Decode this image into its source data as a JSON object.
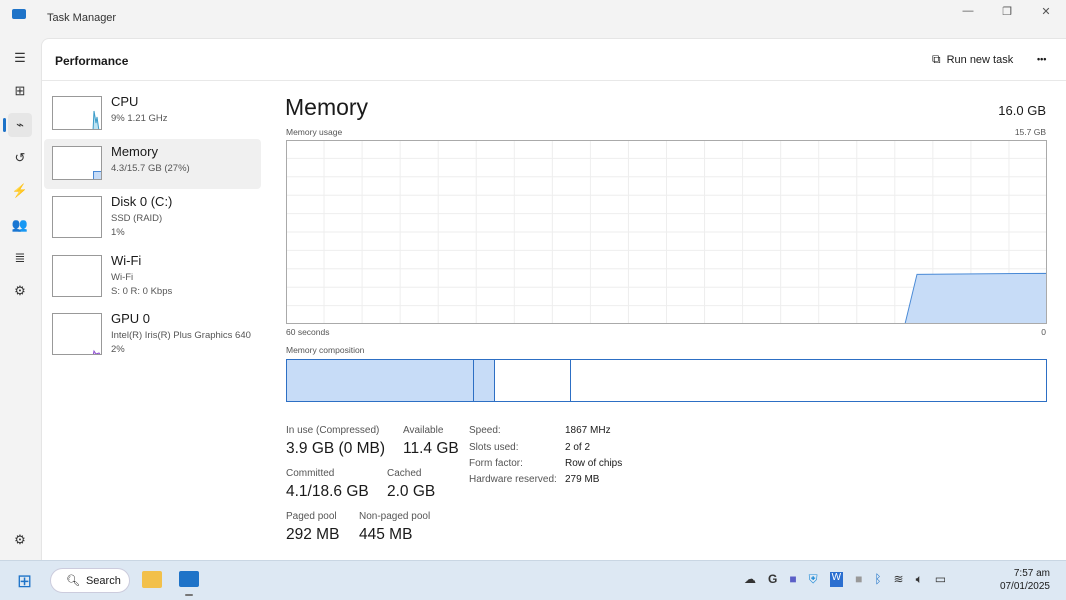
{
  "app": {
    "title": "Task Manager"
  },
  "header": {
    "title": "Performance",
    "run_new_task": "Run new task",
    "more": "•••"
  },
  "sidebar": {
    "items": [
      {
        "name": "CPU",
        "line1": "9%  1.21 GHz",
        "line2": ""
      },
      {
        "name": "Memory",
        "line1": "4.3/15.7 GB (27%)",
        "line2": ""
      },
      {
        "name": "Disk 0 (C:)",
        "line1": "SSD (RAID)",
        "line2": "1%"
      },
      {
        "name": "Wi-Fi",
        "line1": "Wi-Fi",
        "line2": "S: 0  R: 0 Kbps"
      },
      {
        "name": "GPU 0",
        "line1": "Intel(R) Iris(R) Plus Graphics 640",
        "line2": "2%"
      }
    ]
  },
  "main": {
    "title": "Memory",
    "total": "16.0 GB",
    "usage_label": "Memory usage",
    "usage_max": "15.7 GB",
    "axis_left": "60 seconds",
    "axis_right": "0",
    "usage_fraction": 0.27,
    "composition_label": "Memory composition",
    "stats": {
      "in_use_label": "In use (Compressed)",
      "in_use": "3.9 GB (0 MB)",
      "available_label": "Available",
      "available": "11.4 GB",
      "committed_label": "Committed",
      "committed": "4.1/18.6 GB",
      "cached_label": "Cached",
      "cached": "2.0 GB",
      "paged_label": "Paged pool",
      "paged": "292 MB",
      "nonpaged_label": "Non-paged pool",
      "nonpaged": "445 MB"
    },
    "details": [
      {
        "label": "Speed:",
        "value": "1867 MHz"
      },
      {
        "label": "Slots used:",
        "value": "2 of 2"
      },
      {
        "label": "Form factor:",
        "value": "Row of chips"
      },
      {
        "label": "Hardware reserved:",
        "value": "279 MB"
      }
    ]
  },
  "colors": {
    "accent": "#1e73c8",
    "memory_fill": "#c7dcf7",
    "memory_line": "#4a8ad6"
  },
  "taskbar": {
    "search": "Search",
    "time": "7:57 am",
    "date": "07/01/2025"
  }
}
